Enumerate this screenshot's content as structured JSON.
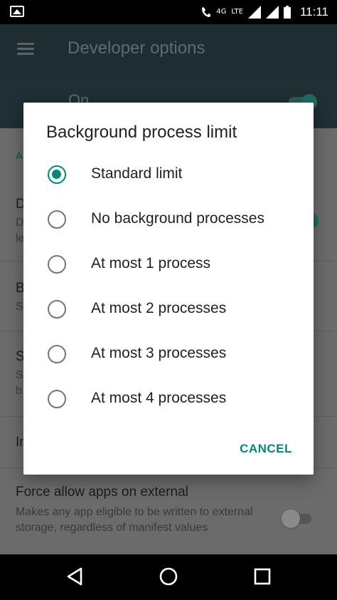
{
  "status_bar": {
    "network_label": "4G",
    "lte_label": "LTE",
    "time": "11:11",
    "icons": [
      "image-notification-icon",
      "wifi-call-icon",
      "signal-icon",
      "signal-icon",
      "battery-icon"
    ]
  },
  "app_bar": {
    "title": "Developer options",
    "menu_icon": "hamburger-menu-icon"
  },
  "master_switch": {
    "label": "On",
    "state": "on"
  },
  "background_list": {
    "partial_letters": [
      "A",
      "D",
      "D",
      "le",
      "B",
      "S",
      "S",
      "S",
      "b",
      "In"
    ],
    "force_allow": {
      "title": "Force allow apps on external",
      "description": "Makes any app eligible to be written to external storage, regardless of manifest values",
      "state": "off"
    }
  },
  "dialog": {
    "title": "Background process limit",
    "options": [
      {
        "label": "Standard limit",
        "checked": true
      },
      {
        "label": "No background processes",
        "checked": false
      },
      {
        "label": "At most 1 process",
        "checked": false
      },
      {
        "label": "At most 2 processes",
        "checked": false
      },
      {
        "label": "At most 3 processes",
        "checked": false
      },
      {
        "label": "At most 4 processes",
        "checked": false
      }
    ],
    "cancel_label": "CANCEL"
  },
  "nav_bar": {
    "buttons": [
      "back-icon",
      "home-icon",
      "recents-icon"
    ]
  },
  "colors": {
    "accent": "#00897b",
    "app_bar": "#1d2d32",
    "scrim_background": "#6b6b6b"
  }
}
